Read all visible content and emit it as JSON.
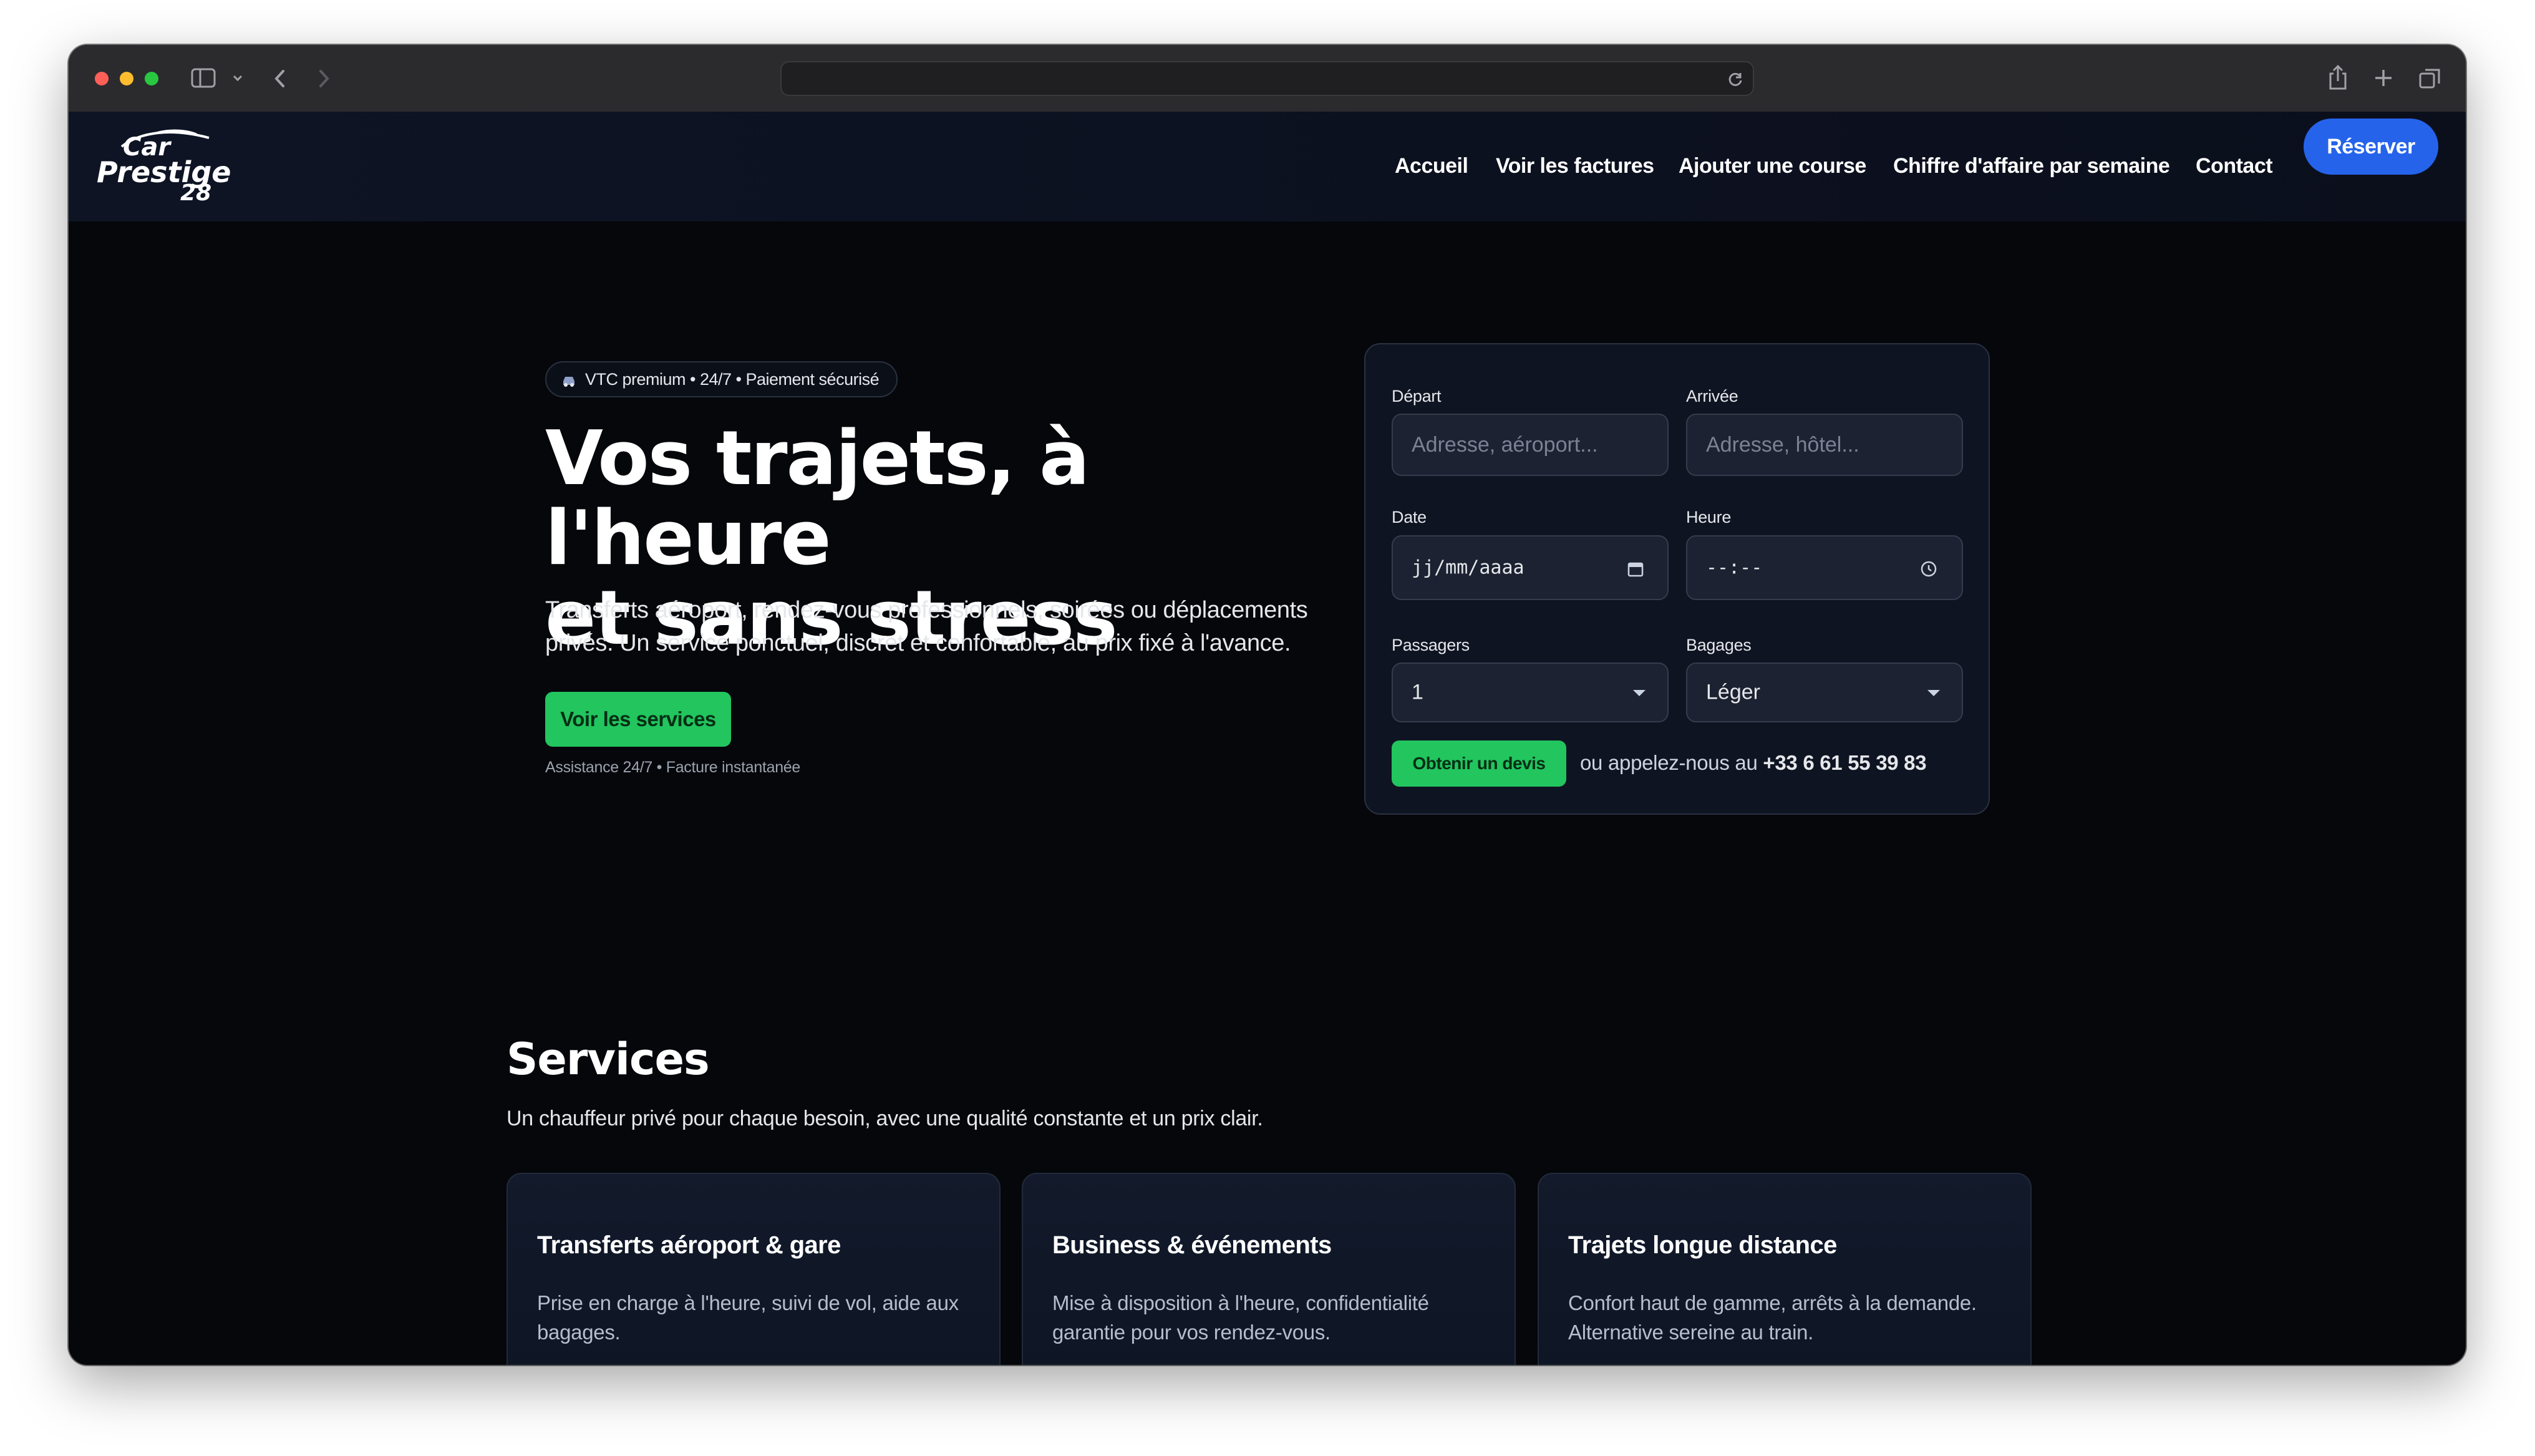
{
  "brand": {
    "logo_line1": "Car",
    "logo_line2": "Prestige",
    "logo_line3": "28"
  },
  "nav": {
    "links": [
      "Accueil",
      "Voir les factures",
      "Ajouter une course",
      "Chiffre d'affaire par semaine",
      "Contact"
    ],
    "cta": "Réserver"
  },
  "hero": {
    "badge": "VTC premium • 24/7 • Paiement sécurisé",
    "title_line1": "Vos trajets, à l'heure",
    "title_line2": "et sans stress",
    "subtitle_line1": "Transferts aéroport, rendez-vous professionnels, soirées ou déplacements",
    "subtitle_line2": "privés. Un service ponctuel, discret et confortable, au prix fixé à l'avance.",
    "cta": "Voir les services",
    "assist": "Assistance 24/7 • Facture instantanée"
  },
  "quote_form": {
    "depart_label": "Départ",
    "depart_placeholder": "Adresse, aéroport...",
    "arrivee_label": "Arrivée",
    "arrivee_placeholder": "Adresse, hôtel...",
    "date_label": "Date",
    "date_value": "jj/mm/aaaa",
    "heure_label": "Heure",
    "heure_value": "--:--",
    "passagers_label": "Passagers",
    "passagers_value": "1",
    "bagages_label": "Bagages",
    "bagages_value": "Léger",
    "submit": "Obtenir un devis",
    "call_prefix": "ou appelez-nous au",
    "phone": "+33 6 61 55 39 83"
  },
  "services": {
    "title": "Services",
    "subtitle": "Un chauffeur privé pour chaque besoin, avec une qualité constante et un prix clair.",
    "items": [
      {
        "title": "Transferts aéroport & gare",
        "desc_line1": "Prise en charge à l'heure, suivi de vol, aide aux",
        "desc_line2": "bagages."
      },
      {
        "title": "Business & événements",
        "desc_line1": "Mise à disposition à l'heure, confidentialité",
        "desc_line2": "garantie pour vos rendez-vous."
      },
      {
        "title": "Trajets longue distance",
        "desc_line1": "Confort haut de gamme, arrêts à la demande.",
        "desc_line2": "Alternative sereine au train."
      }
    ]
  },
  "colors": {
    "accent_blue": "#2563eb",
    "accent_green": "#22c55e",
    "background": "#05070b"
  }
}
